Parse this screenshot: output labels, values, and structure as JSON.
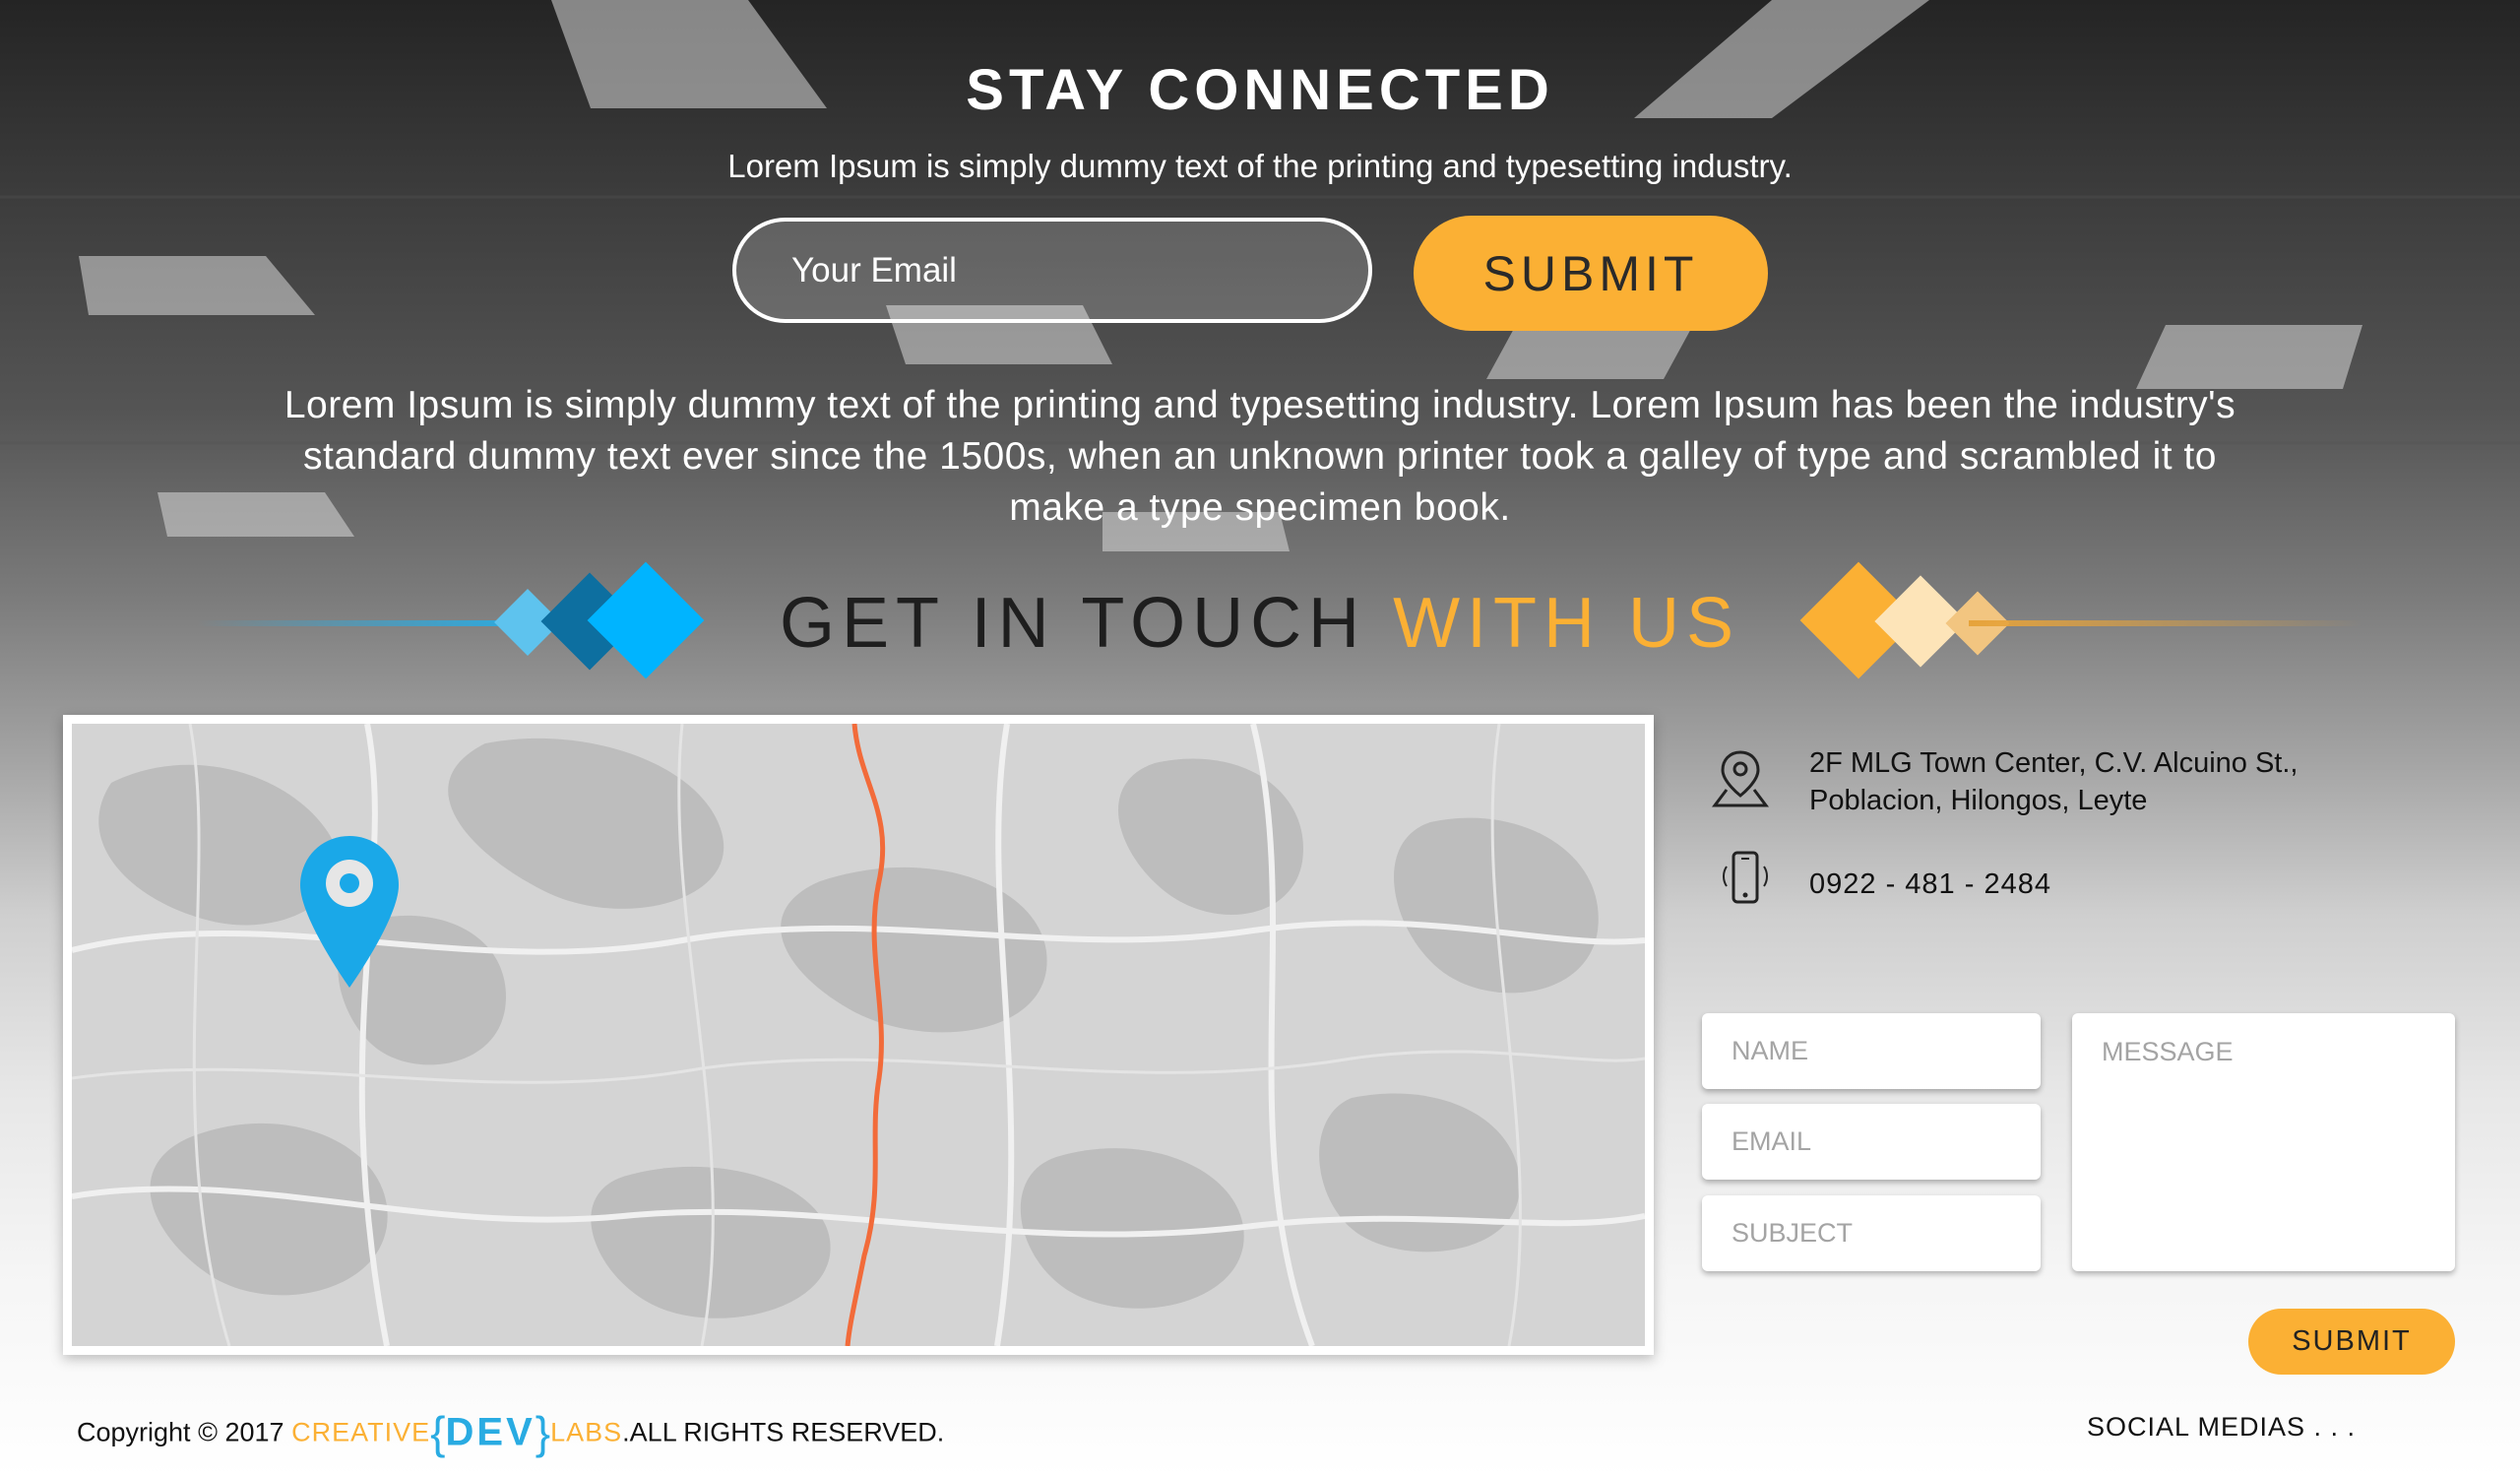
{
  "newsletter": {
    "title": "STAY CONNECTED",
    "subtitle": "Lorem Ipsum is simply dummy text of the printing and typesetting industry.",
    "email_placeholder": "Your Email",
    "submit_label": "SUBMIT"
  },
  "intro_text": "Lorem Ipsum is simply dummy text of the printing and typesetting industry. Lorem Ipsum has been the industry's standard dummy text ever since the 1500s, when an unknown printer took a galley of type and scrambled it to make a type specimen book.",
  "contact": {
    "heading_main": "GET IN TOUCH ",
    "heading_accent": "WITH US",
    "address_line1": "2F MLG Town Center, C.V. Alcuino St.,",
    "address_line2": "Poblacion, Hilongos, Leyte",
    "phone": "0922 - 481 - 2484"
  },
  "form": {
    "name_placeholder": "NAME",
    "email_placeholder": "EMAIL",
    "subject_placeholder": "SUBJECT",
    "message_placeholder": "MESSAGE",
    "submit_label": "SUBMIT"
  },
  "footer": {
    "copyright": "Copyright",
    "copyright_symbol": "©",
    "year": "2017",
    "brand_creative": "CREATIVE",
    "brand_open": "{",
    "brand_dev": "DEV",
    "brand_close": "}",
    "brand_labs": "LABS",
    "rights": ".ALL RIGHTS RESERVED.",
    "social": "SOCIAL MEDIAS . . ."
  },
  "colors": {
    "accent_orange": "#fbb034",
    "accent_blue": "#29abe2",
    "map_route": "#f26b3a"
  },
  "icons": {
    "location": "location-pin-icon",
    "phone": "mobile-phone-icon",
    "map_marker": "map-marker-icon"
  }
}
